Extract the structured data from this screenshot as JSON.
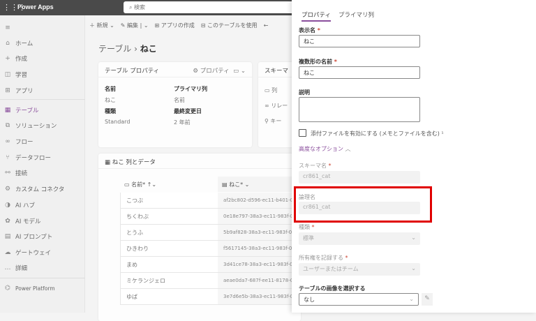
{
  "app": {
    "title": "Power Apps",
    "search_placeholder": "検索"
  },
  "sidebar": {
    "items": [
      {
        "icon": "hamburger-icon",
        "label": ""
      },
      {
        "icon": "home-icon",
        "label": "ホーム"
      },
      {
        "icon": "plus-icon",
        "label": "作成"
      },
      {
        "icon": "book-icon",
        "label": "学習"
      },
      {
        "icon": "apps-icon",
        "label": "アプリ"
      },
      {
        "icon": "table-icon",
        "label": "テーブル",
        "active": true
      },
      {
        "icon": "solution-icon",
        "label": "ソリューション"
      },
      {
        "icon": "flow-icon",
        "label": "フロー"
      },
      {
        "icon": "dataflow-icon",
        "label": "データフロー"
      },
      {
        "icon": "connection-icon",
        "label": "接続"
      },
      {
        "icon": "custom-connector-icon",
        "label": "カスタム コネクタ"
      },
      {
        "icon": "ai-hub-icon",
        "label": "AI ハブ"
      },
      {
        "icon": "ai-model-icon",
        "label": "AI モデル"
      },
      {
        "icon": "ai-prompt-icon",
        "label": "AI プロンプト"
      },
      {
        "icon": "gateway-icon",
        "label": "ゲートウェイ"
      },
      {
        "icon": "more-icon",
        "label": "詳細"
      },
      {
        "icon": "power-platform-icon",
        "label": "Power Platform"
      }
    ]
  },
  "commandbar": {
    "new": "新規",
    "edit": "編集",
    "create_app": "アプリの作成",
    "use_table": "このテーブルを使用"
  },
  "breadcrumb": {
    "parent": "テーブル",
    "current": "ねこ"
  },
  "table_props": {
    "title": "テーブル プロパティ",
    "properties_btn": "プロパティ",
    "name_label": "名前",
    "name_value": "ねこ",
    "primary_label": "プライマリ列",
    "primary_value": "名前",
    "type_label": "種類",
    "type_value": "Standard",
    "modified_label": "最終変更日",
    "modified_value": "2 年前"
  },
  "schema": {
    "title": "スキーマ",
    "columns": "列",
    "relationships": "リレー",
    "keys": "キー"
  },
  "data": {
    "title": "ねこ 列とデータ",
    "col1": "名前",
    "col2": "ねこ",
    "rows": [
      {
        "name": "こつぶ",
        "id": "af2bc802-d596-ec11-b401-0"
      },
      {
        "name": "ちくわぶ",
        "id": "0e18e797-38a3-ec11-983f-0"
      },
      {
        "name": "とうふ",
        "id": "5b9af828-38a3-ec11-983f-0"
      },
      {
        "name": "ひきわり",
        "id": "f5617145-38a3-ec11-983f-0"
      },
      {
        "name": "まめ",
        "id": "3d41ce78-38a3-ec11-983f-0"
      },
      {
        "name": "ミケランジェロ",
        "id": "aeae0da7-687f-ee11-8178-0"
      },
      {
        "name": "ゆば",
        "id": "3e7d6e5b-38a3-ec11-983f-0"
      }
    ]
  },
  "panel": {
    "tabs": [
      "プロパティ",
      "プライマリ列"
    ],
    "display_name_label": "表示名",
    "display_name": "ねこ",
    "plural_label": "複数形の名前",
    "plural": "ねこ",
    "description_label": "説明",
    "description": "",
    "attachments_label": "添付ファイルを有効にする (メモとファイルを含む)",
    "attachments_checked": false,
    "advanced": "高度なオプション",
    "schema_label": "スキーマ名",
    "schema_value": "cr861_cat",
    "logical_label": "論理名",
    "logical_value": "cr861_cat",
    "type_label": "種類",
    "type_value": "標準",
    "ownership_label": "所有権を記録する",
    "ownership_value": "ユーザーまたはチーム",
    "image_label": "テーブルの画像を選択する",
    "image_value": "なし"
  },
  "colors": {
    "accent": "#8a4e9c",
    "highlight": "#e00000"
  }
}
